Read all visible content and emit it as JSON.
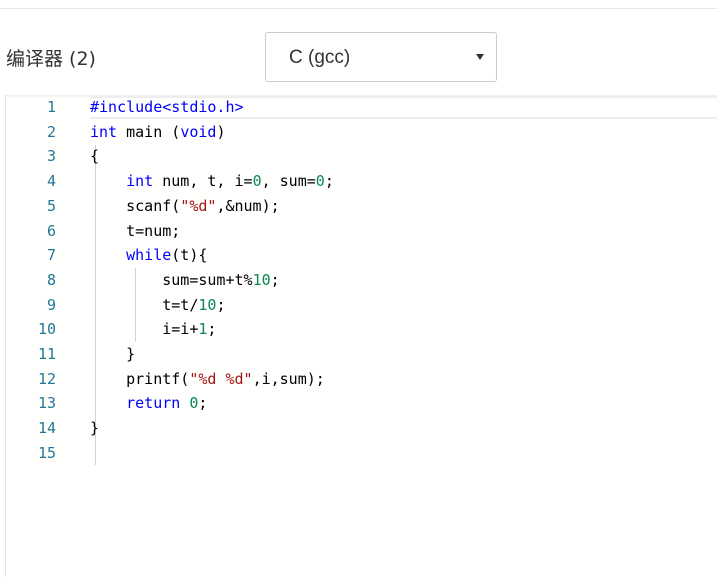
{
  "toolbar": {
    "compiler_label": "编译器 (2)",
    "compiler_select": {
      "value": "C (gcc)"
    }
  },
  "editor": {
    "line_numbers": [
      "1",
      "2",
      "3",
      "4",
      "5",
      "6",
      "7",
      "8",
      "9",
      "10",
      "11",
      "12",
      "13",
      "14",
      "15"
    ],
    "current_line": 1,
    "lines": [
      [
        {
          "t": "#include<stdio.h>",
          "c": "kw"
        }
      ],
      [
        {
          "t": "int",
          "c": "kw"
        },
        {
          "t": " main (",
          "c": ""
        },
        {
          "t": "void",
          "c": "kw"
        },
        {
          "t": ")",
          "c": ""
        }
      ],
      [
        {
          "t": "{",
          "c": ""
        }
      ],
      [
        {
          "t": "    ",
          "c": ""
        },
        {
          "t": "int",
          "c": "kw"
        },
        {
          "t": " num, t, i=",
          "c": ""
        },
        {
          "t": "0",
          "c": "num"
        },
        {
          "t": ", sum=",
          "c": ""
        },
        {
          "t": "0",
          "c": "num"
        },
        {
          "t": ";",
          "c": ""
        }
      ],
      [
        {
          "t": "    scanf(",
          "c": ""
        },
        {
          "t": "\"%d\"",
          "c": "str"
        },
        {
          "t": ",&num);",
          "c": ""
        }
      ],
      [
        {
          "t": "    t=num;",
          "c": ""
        }
      ],
      [
        {
          "t": "    ",
          "c": ""
        },
        {
          "t": "while",
          "c": "kw"
        },
        {
          "t": "(t){",
          "c": ""
        }
      ],
      [
        {
          "t": "        sum=sum+t%",
          "c": ""
        },
        {
          "t": "10",
          "c": "num"
        },
        {
          "t": ";",
          "c": ""
        }
      ],
      [
        {
          "t": "        t=t/",
          "c": ""
        },
        {
          "t": "10",
          "c": "num"
        },
        {
          "t": ";",
          "c": ""
        }
      ],
      [
        {
          "t": "        i=i+",
          "c": ""
        },
        {
          "t": "1",
          "c": "num"
        },
        {
          "t": ";",
          "c": ""
        }
      ],
      [
        {
          "t": "    }",
          "c": ""
        }
      ],
      [
        {
          "t": "    printf(",
          "c": ""
        },
        {
          "t": "\"%d %d\"",
          "c": "str"
        },
        {
          "t": ",i,sum);",
          "c": ""
        }
      ],
      [
        {
          "t": "    ",
          "c": ""
        },
        {
          "t": "return",
          "c": "kw"
        },
        {
          "t": " ",
          "c": ""
        },
        {
          "t": "0",
          "c": "num"
        },
        {
          "t": ";",
          "c": ""
        }
      ],
      [
        {
          "t": "}",
          "c": ""
        }
      ],
      []
    ],
    "syntax_colors": {
      "keyword": "#0000ff",
      "string": "#a31515",
      "number": "#098658",
      "line_number": "#237893"
    }
  }
}
